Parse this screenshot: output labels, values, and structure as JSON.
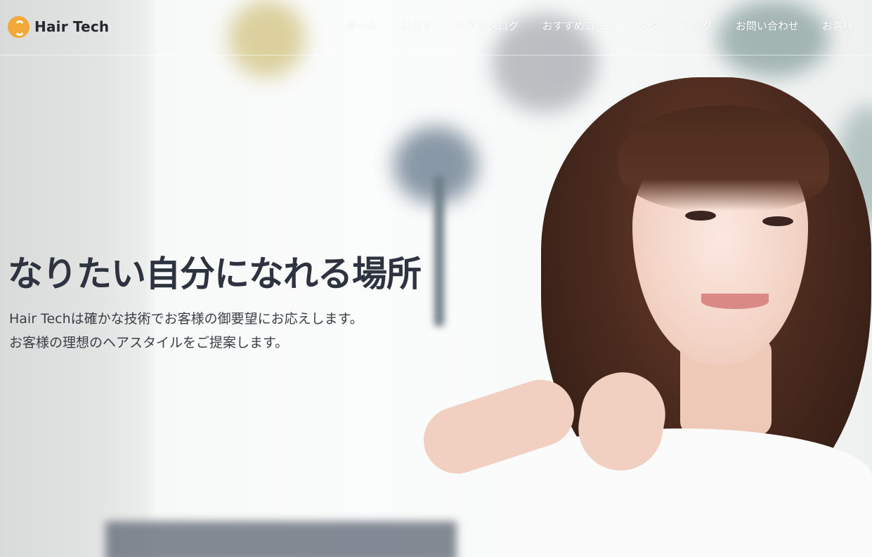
{
  "header": {
    "logo_text": "Hair Tech",
    "nav": [
      {
        "label": "ホーム"
      },
      {
        "label": "口コミ"
      },
      {
        "label": "ヘアカタログ"
      },
      {
        "label": "おすすめコース"
      },
      {
        "label": "スタッフブログ"
      },
      {
        "label": "お問い合わせ"
      },
      {
        "label": "お客様"
      }
    ]
  },
  "hero": {
    "title": "なりたい自分になれる場所",
    "lines": [
      "Hair Techは確かな技術でお客様の御要望にお応えします。",
      "お客様の理想のヘアスタイルをご提案します。"
    ]
  },
  "colors": {
    "brand": "#f2a93b",
    "title_text": "#2d3440",
    "nav_text": "#ffffff"
  }
}
